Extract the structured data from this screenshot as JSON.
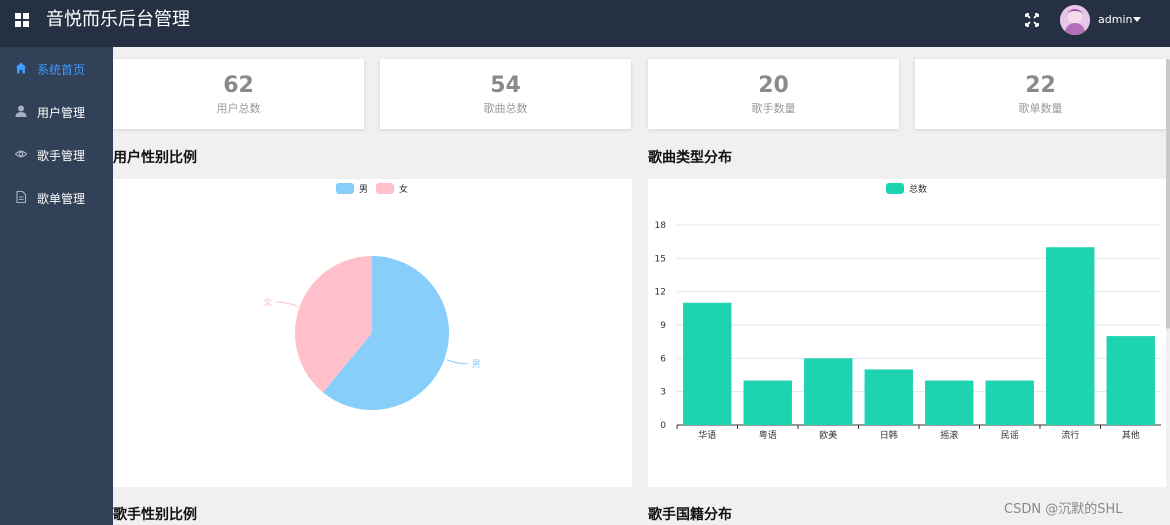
{
  "header": {
    "title": "音悦而乐后台管理",
    "username": "admin"
  },
  "sidebar": {
    "items": [
      {
        "label": "系统首页",
        "icon": "home-icon",
        "active": true
      },
      {
        "label": "用户管理",
        "icon": "user-icon",
        "active": false
      },
      {
        "label": "歌手管理",
        "icon": "eye-icon",
        "active": false
      },
      {
        "label": "歌单管理",
        "icon": "document-icon",
        "active": false
      }
    ]
  },
  "stats": [
    {
      "value": "62",
      "label": "用户总数"
    },
    {
      "value": "54",
      "label": "歌曲总数"
    },
    {
      "value": "20",
      "label": "歌手数量"
    },
    {
      "value": "22",
      "label": "歌单数量"
    }
  ],
  "sections": {
    "user_gender": "用户性别比例",
    "song_types": "歌曲类型分布",
    "singer_gender": "歌手性别比例",
    "singer_nationality": "歌手国籍分布"
  },
  "chart_data": [
    {
      "type": "pie",
      "legend": [
        "男",
        "女"
      ],
      "slices": [
        {
          "name": "男",
          "value": 0.61,
          "color": "#87cefa"
        },
        {
          "name": "女",
          "value": 0.39,
          "color": "#ffc0cb"
        }
      ],
      "legend_position": "top-center"
    },
    {
      "type": "bar",
      "categories": [
        "华语",
        "粤语",
        "欧美",
        "日韩",
        "摇滚",
        "民谣",
        "流行",
        "其他"
      ],
      "series": [
        {
          "name": "总数",
          "values": [
            11,
            4,
            6,
            5,
            4,
            4,
            16,
            8
          ],
          "color": "#1dd3b0"
        }
      ],
      "ylim": [
        0,
        18
      ],
      "yticks": [
        0,
        3,
        6,
        9,
        12,
        15,
        18
      ],
      "grid": true,
      "legend_position": "top-center"
    }
  ],
  "watermark": "CSDN @沉默的SHL"
}
